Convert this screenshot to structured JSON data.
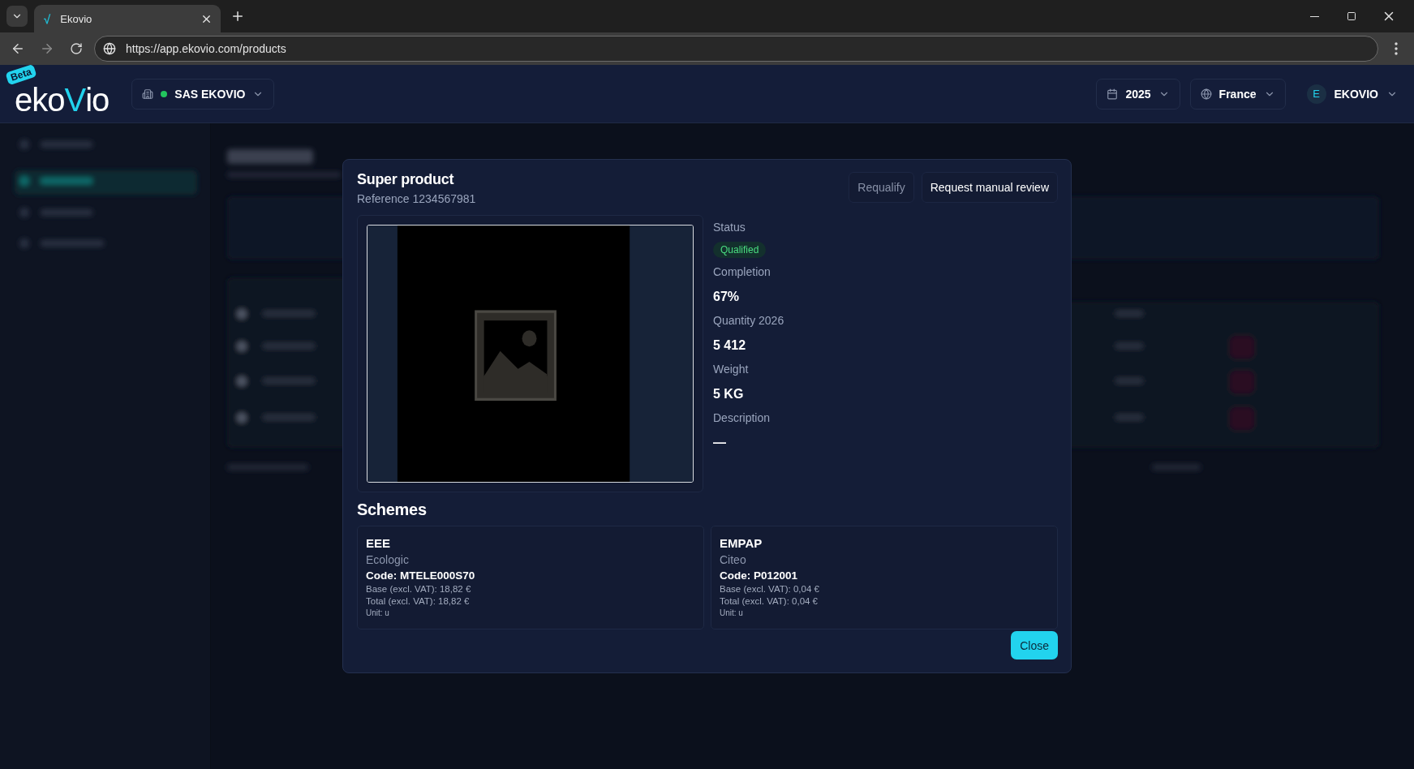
{
  "browser": {
    "tab_title": "Ekovio",
    "favicon": "√",
    "url": "https://app.ekovio.com/products"
  },
  "header": {
    "logo": {
      "badge": "Beta",
      "segments": [
        {
          "text": "eko",
          "accent": false
        },
        {
          "text": "V",
          "accent": true
        },
        {
          "text": "io",
          "accent": false
        }
      ]
    },
    "company": {
      "name": "SAS EKOVIO",
      "online": true
    },
    "year": "2025",
    "country": "France",
    "user": {
      "initial": "E",
      "name": "EKOVIO"
    }
  },
  "modal": {
    "title": "Super product",
    "reference": "Reference 1234567981",
    "buttons": [
      {
        "label": "Requalify",
        "disabled": true
      },
      {
        "label": "Request manual review",
        "disabled": false
      }
    ],
    "fields": [
      {
        "label": "Status",
        "value": "Qualified",
        "kind": "badge"
      },
      {
        "label": "Completion",
        "value": "67%",
        "kind": "text"
      },
      {
        "label": "Quantity 2026",
        "value": "5 412",
        "kind": "text"
      },
      {
        "label": "Weight",
        "value": "5 KG",
        "kind": "text"
      },
      {
        "label": "Description",
        "value": "—",
        "kind": "text"
      }
    ],
    "schemes_title": "Schemes",
    "schemes": [
      {
        "name": "EEE",
        "organization": "Ecologic",
        "code": "Code: MTELE000S70",
        "base": "Base (excl. VAT): 18,82 €",
        "total": "Total (excl. VAT): 18,82 €",
        "unit": "Unit: u"
      },
      {
        "name": "EMPAP",
        "organization": "Citeo",
        "code": "Code: P012001",
        "base": "Base (excl. VAT): 0,04 €",
        "total": "Total (excl. VAT): 0,04 €",
        "unit": "Unit: u"
      }
    ],
    "close_label": "Close"
  }
}
